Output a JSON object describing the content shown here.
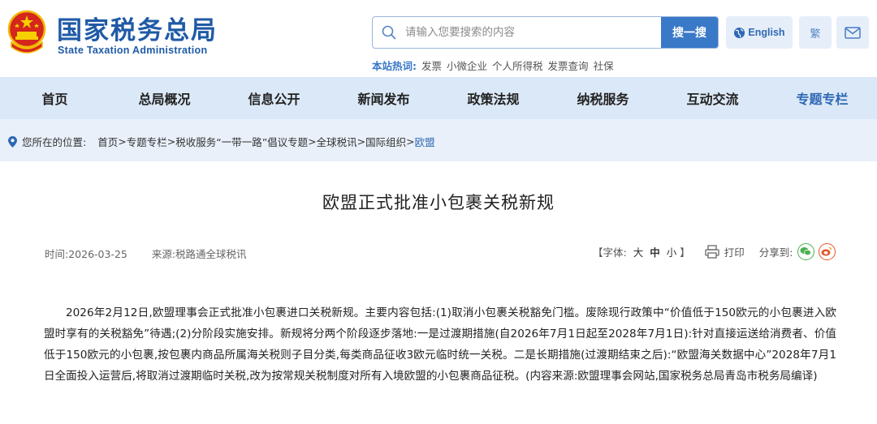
{
  "header": {
    "logo_cn": "国家税务总局",
    "logo_en": "State Taxation Administration",
    "search": {
      "placeholder": "请输入您要搜索的内容",
      "button_label": "搜一搜"
    },
    "english_label": "English",
    "traditional_label": "繁",
    "hot_label": "本站热词:",
    "hot_words": [
      "发票",
      "小微企业",
      "个人所得税",
      "发票查询",
      "社保"
    ]
  },
  "nav": {
    "items": [
      "首页",
      "总局概况",
      "信息公开",
      "新闻发布",
      "政策法规",
      "纳税服务",
      "互动交流",
      "专题专栏"
    ],
    "active_index": 7
  },
  "breadcrumb": {
    "label": "您所在的位置:",
    "items": [
      "首页",
      "专题专栏",
      "税收服务“一带一路”倡议专题",
      "全球税讯",
      "国际组织",
      "欧盟"
    ],
    "separator": ">"
  },
  "article": {
    "title": "欧盟正式批准小包裹关税新规",
    "date_text": "时间:2026-03-25",
    "source_text": "来源:税路通全球税讯",
    "font_label": "【字体:",
    "font_big": "大",
    "font_mid": "中",
    "font_small": "小",
    "font_end": "】",
    "print_label": "打印",
    "share_label": "分享到:",
    "body": "2026年2月12日,欧盟理事会正式批准小包裹进口关税新规。主要内容包括:(1)取消小包裹关税豁免门槛。废除现行政策中“价值低于150欧元的小包裹进入欧盟时享有的关税豁免”待遇;(2)分阶段实施安排。新规将分两个阶段逐步落地:一是过渡期措施(自2026年7月1日起至2028年7月1日):针对直接运送给消费者、价值低于150欧元的小包裹,按包裹内商品所属海关税则子目分类,每类商品征收3欧元临时统一关税。二是长期措施(过渡期结束之后):“欧盟海关数据中心”2028年7月1日全面投入运营后,将取消过渡期临时关税,改为按常规关税制度对所有入境欧盟的小包裹商品征税。(内容来源:欧盟理事会网站,国家税务总局青岛市税务局编译)"
  },
  "colors": {
    "brand": "#1f5aa6",
    "accent": "#3a78c8",
    "nav_bg": "#dbe8f7",
    "crumb_bg": "#e9f0fa"
  }
}
